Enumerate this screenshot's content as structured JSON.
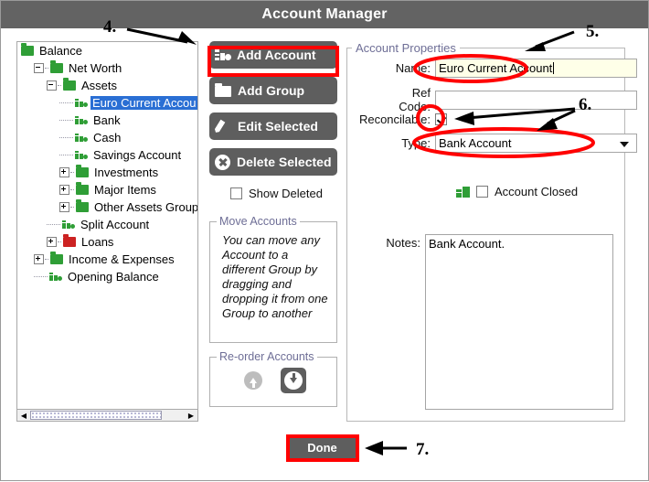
{
  "window": {
    "title": "Account Manager"
  },
  "tree": {
    "nodes": [
      {
        "label": "Balance",
        "icon": "folder-green-icon",
        "depth": 0,
        "expander": "none",
        "selected": false
      },
      {
        "label": "Net Worth",
        "icon": "folder-green-icon",
        "depth": 1,
        "expander": "minus",
        "selected": false
      },
      {
        "label": "Assets",
        "icon": "folder-green-icon",
        "depth": 2,
        "expander": "minus",
        "selected": false
      },
      {
        "label": "Euro Current Accou",
        "icon": "account-icon",
        "depth": 3,
        "expander": "none",
        "selected": true
      },
      {
        "label": "Bank",
        "icon": "account-icon",
        "depth": 3,
        "expander": "none",
        "selected": false
      },
      {
        "label": "Cash",
        "icon": "account-icon",
        "depth": 3,
        "expander": "none",
        "selected": false
      },
      {
        "label": "Savings Account",
        "icon": "account-icon",
        "depth": 3,
        "expander": "none",
        "selected": false
      },
      {
        "label": "Investments",
        "icon": "folder-green-icon",
        "depth": 3,
        "expander": "plus",
        "selected": false
      },
      {
        "label": "Major Items",
        "icon": "folder-green-icon",
        "depth": 3,
        "expander": "plus",
        "selected": false
      },
      {
        "label": "Other Assets Group",
        "icon": "folder-green-icon",
        "depth": 3,
        "expander": "plus",
        "selected": false
      },
      {
        "label": "Split Account",
        "icon": "account-icon",
        "depth": 2,
        "expander": "none",
        "selected": false
      },
      {
        "label": "Loans",
        "icon": "folder-red-icon",
        "depth": 2,
        "expander": "plus",
        "selected": false
      },
      {
        "label": "Income & Expenses",
        "icon": "folder-green-icon",
        "depth": 1,
        "expander": "plus",
        "selected": false
      },
      {
        "label": "Opening Balance",
        "icon": "account-icon",
        "depth": 1,
        "expander": "none",
        "selected": false
      }
    ],
    "scrollbar": {
      "left_arrow": "◀",
      "right_arrow": "▶"
    }
  },
  "actions": {
    "add_account": "Add Account",
    "add_group": "Add Group",
    "edit_selected": "Edit Selected",
    "delete_selected": "Delete Selected",
    "show_deleted": "Show Deleted",
    "show_deleted_checked": false
  },
  "move_accounts": {
    "legend": "Move Accounts",
    "text": "You can move any Account to a different Group by dragging and dropping it from one Group to another"
  },
  "reorder_accounts": {
    "legend": "Re-order Accounts",
    "move_up": "move-up",
    "move_down": "move-down"
  },
  "properties": {
    "legend": "Account Properties",
    "name_label": "Name:",
    "name_value": "Euro Current Account",
    "ref_code_label": "Ref Code:",
    "ref_code_value": "",
    "reconcilable_label": "Reconcilable:",
    "reconcilable_checked": true,
    "type_label": "Type:",
    "type_value": "Bank Account",
    "account_closed_label": "Account Closed",
    "account_closed_checked": false,
    "notes_label": "Notes:",
    "notes_value": "Bank Account."
  },
  "footer": {
    "done": "Done"
  },
  "annotations": {
    "step4": "4.",
    "step5": "5.",
    "step6": "6.",
    "step7": "7."
  },
  "colors": {
    "titlebar": "#636363",
    "button": "#5e5e5e",
    "highlight": "#ff0000",
    "selection": "#2a6fd4",
    "folder_green": "#2f9e36",
    "folder_red": "#cc2222",
    "name_field_bg": "#feffe8"
  }
}
